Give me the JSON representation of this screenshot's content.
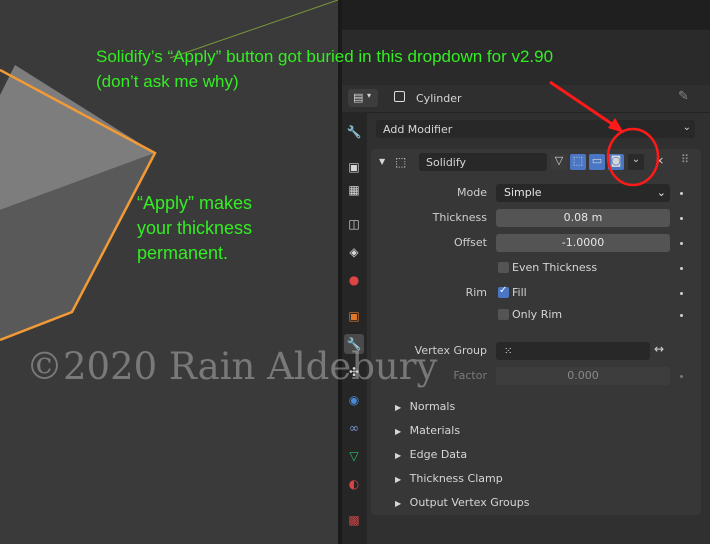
{
  "annotations": {
    "headline_line1": "Solidify’s “Apply” button got buried in this dropdown for v2.90",
    "headline_line2": "(don’t ask me why)",
    "side_line1": "“Apply” makes",
    "side_line2": "your thickness",
    "side_line3": "permanent.",
    "color": "#33ee22",
    "circle_color": "#ff1a1a"
  },
  "watermark": "©2020 Rain Aldebury",
  "properties": {
    "object_name": "Cylinder",
    "add_modifier_label": "Add Modifier",
    "modifier": {
      "name": "Solidify",
      "fields": {
        "mode_label": "Mode",
        "mode_value": "Simple",
        "thickness_label": "Thickness",
        "thickness_value": "0.08 m",
        "offset_label": "Offset",
        "offset_value": "-1.0000",
        "even_thickness_label": "Even Thickness",
        "even_thickness_checked": false,
        "rim_label": "Rim",
        "fill_label": "Fill",
        "fill_checked": true,
        "only_rim_label": "Only Rim",
        "only_rim_checked": false,
        "vertex_group_label": "Vertex Group",
        "factor_label": "Factor",
        "factor_value": "0.000"
      },
      "subpanels": [
        "Normals",
        "Materials",
        "Edge Data",
        "Thickness Clamp",
        "Output Vertex Groups"
      ]
    }
  },
  "icons": [
    "editor-type-icon",
    "object-icon",
    "pin-icon",
    "tool-tab-icon",
    "render-tab-icon",
    "output-tab-icon",
    "view-layer-tab-icon",
    "scene-tab-icon",
    "world-tab-icon",
    "object-tab-icon",
    "modifier-tab-icon",
    "particles-tab-icon",
    "physics-tab-icon",
    "constraints-tab-icon",
    "data-tab-icon",
    "material-tab-icon",
    "texture-tab-icon"
  ]
}
